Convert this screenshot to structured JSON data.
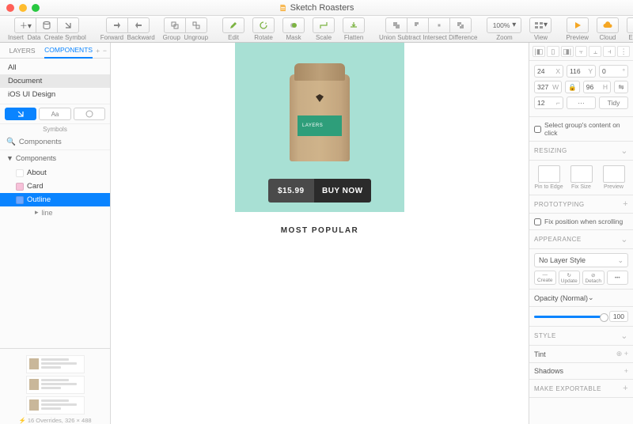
{
  "window": {
    "title": "Sketch Roasters"
  },
  "toolbar": {
    "insert": "Insert",
    "data": "Data",
    "createSymbol": "Create Symbol",
    "forward": "Forward",
    "backward": "Backward",
    "group": "Group",
    "ungroup": "Ungroup",
    "edit": "Edit",
    "rotate": "Rotate",
    "mask": "Mask",
    "scale": "Scale",
    "flatten": "Flatten",
    "union": "Union",
    "subtract": "Subtract",
    "intersect": "Intersect",
    "difference": "Difference",
    "zoom": "Zoom",
    "zoomValue": "100%",
    "view": "View",
    "preview": "Preview",
    "cloud": "Cloud",
    "export": "Export"
  },
  "sidebar": {
    "tabs": {
      "layers": "LAYERS",
      "components": "COMPONENTS"
    },
    "filters": [
      "All",
      "Document",
      "iOS UI Design"
    ],
    "actionLabel": "Aa",
    "symbols": "Symbols",
    "searchPlaceholder": "Components",
    "treeHeader": "Components",
    "items": [
      {
        "label": "About",
        "color": "#ffffff"
      },
      {
        "label": "Card",
        "color": "#f7c1d9"
      },
      {
        "label": "Outline",
        "color": "#0a84ff",
        "selected": true
      }
    ],
    "childItem": "line",
    "previewFooter": "⚡ 16 Overrides, 326 × 488"
  },
  "artboard": {
    "bagLabel": "LAYERS",
    "price": "$15.99",
    "buy": "BUY NOW",
    "section": "MOST POPULAR"
  },
  "inspector": {
    "position": {
      "x": "24",
      "y": "116",
      "r": "0"
    },
    "size": {
      "w": "327",
      "h": "96",
      "lock": "🔒"
    },
    "corner": {
      "value": "12",
      "tidy": "Tidy"
    },
    "selectContent": "Select group's content on click",
    "resizing": {
      "header": "RESIZING",
      "pin": "Pin to Edge",
      "fix": "Fix Size",
      "preview": "Preview"
    },
    "prototyping": {
      "header": "PROTOTYPING",
      "fix": "Fix position when scrolling"
    },
    "appearance": {
      "header": "APPEARANCE",
      "layerStyle": "No Layer Style",
      "create": "Create",
      "update": "Update",
      "detach": "Detach",
      "more": "•••"
    },
    "opacity": {
      "label": "Opacity (Normal)",
      "value": "100"
    },
    "style": "STYLE",
    "tint": "Tint",
    "shadows": "Shadows",
    "export": "MAKE EXPORTABLE"
  }
}
